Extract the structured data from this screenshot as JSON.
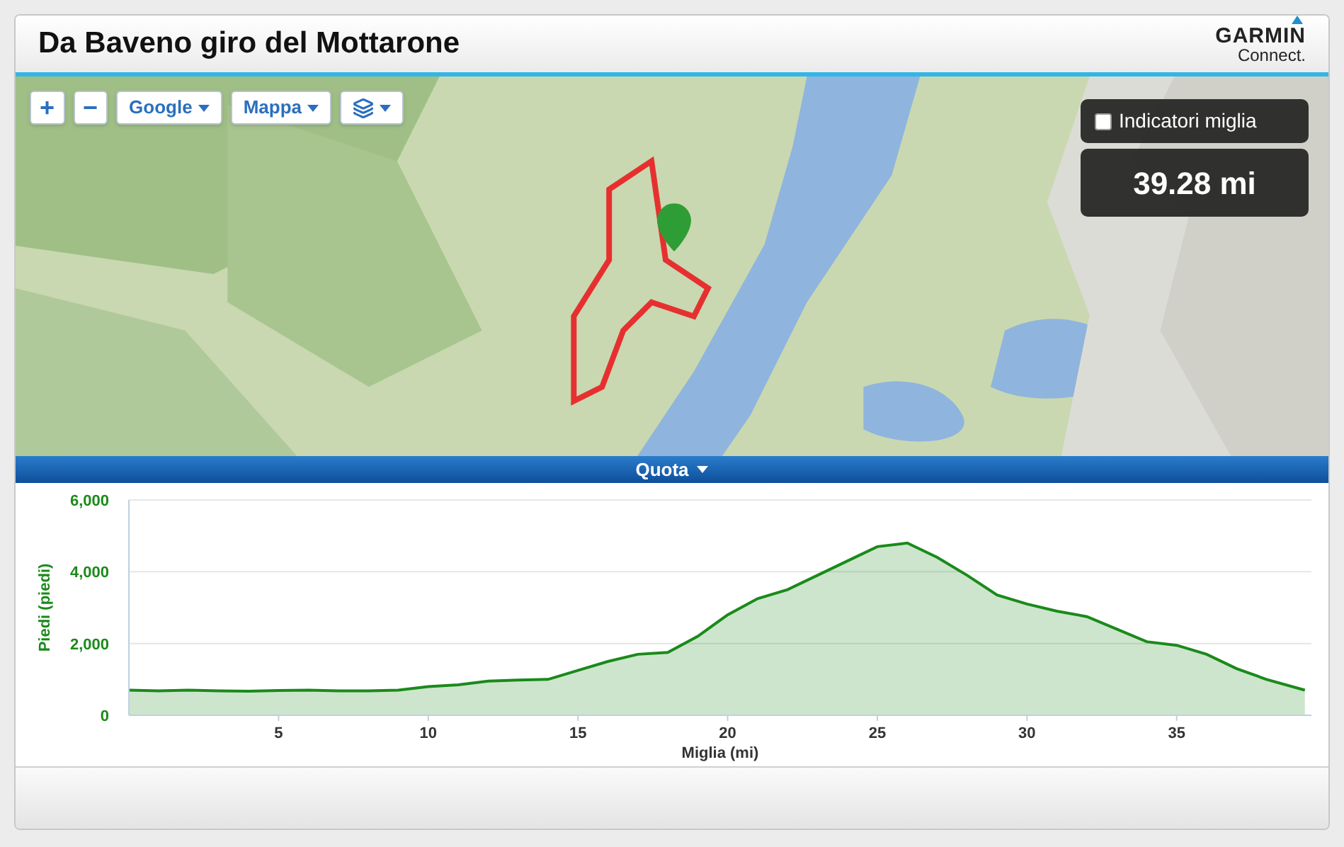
{
  "header": {
    "title": "Da Baveno giro del Mottarone",
    "logo": {
      "brand": "GARMIN",
      "sub": "Connect."
    }
  },
  "map": {
    "controls": [
      {
        "kind": "zoom",
        "label": "+"
      },
      {
        "kind": "zoom",
        "label": "−"
      },
      {
        "kind": "dropdown",
        "label": "Google"
      },
      {
        "kind": "dropdown",
        "label": "Mappa"
      },
      {
        "kind": "layers"
      }
    ],
    "mile_markers": {
      "label": "Indicatori miglia",
      "checked": false
    },
    "distance": "39.28 mi"
  },
  "elevation": {
    "title": "Quota",
    "chart_data": {
      "type": "area",
      "xlabel": "Miglia (mi)",
      "ylabel": "Piedi (piedi)",
      "x": [
        0,
        1,
        2,
        3,
        4,
        5,
        6,
        7,
        8,
        9,
        10,
        11,
        12,
        13,
        14,
        15,
        16,
        17,
        18,
        19,
        20,
        21,
        22,
        23,
        24,
        25,
        26,
        27,
        28,
        29,
        30,
        31,
        32,
        33,
        34,
        35,
        36,
        37,
        38,
        39.28
      ],
      "series": [
        {
          "color": "#1a8a1a",
          "values": [
            700,
            680,
            700,
            680,
            670,
            690,
            700,
            680,
            680,
            700,
            800,
            850,
            950,
            980,
            1000,
            1250,
            1500,
            1700,
            1750,
            2200,
            2800,
            3250,
            3500,
            3900,
            4300,
            4700,
            4800,
            4400,
            3900,
            3350,
            3100,
            2900,
            2750,
            2400,
            2050,
            1950,
            1700,
            1300,
            1000,
            700
          ]
        }
      ],
      "xlim": [
        0,
        39.5
      ],
      "ylim": [
        0,
        6000
      ],
      "xticks": [
        5,
        10,
        15,
        20,
        25,
        30,
        35
      ],
      "yticks": [
        {
          "value": 0,
          "label": "0"
        },
        {
          "value": 2000,
          "label": "2,000"
        },
        {
          "value": 4000,
          "label": "4,000"
        },
        {
          "value": 6000,
          "label": "6,000"
        }
      ]
    }
  }
}
